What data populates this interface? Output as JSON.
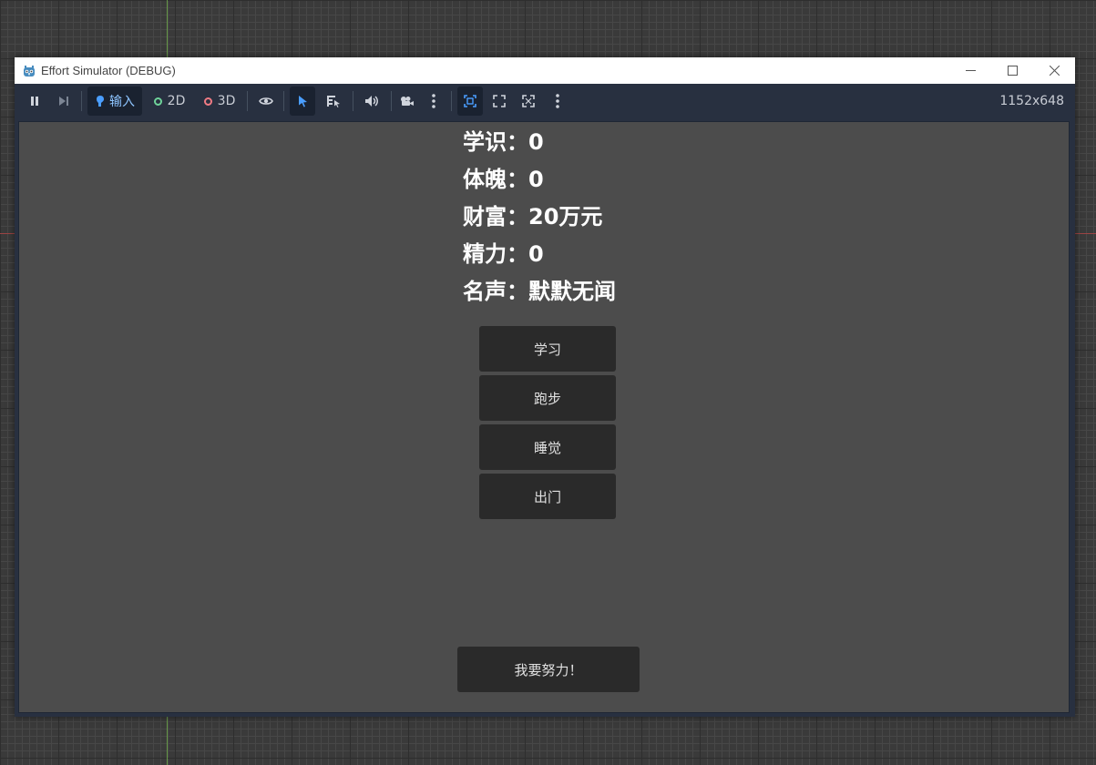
{
  "window": {
    "title": "Effort Simulator (DEBUG)"
  },
  "toolbar": {
    "input_label": "输入",
    "label_2d": "2D",
    "label_3d": "3D",
    "resolution": "1152x648",
    "icons": [
      "pause-icon",
      "step-icon",
      "input-icon",
      "eye-icon",
      "select-icon",
      "list-select-icon",
      "speaker-icon",
      "camera-icon",
      "more-icon",
      "fit-icon",
      "expand-icon",
      "fullscreen-icon",
      "more-icon"
    ],
    "colors": {
      "accent": "#4a9eff",
      "radio_2d": "#6fd39a",
      "radio_3d": "#f07b84"
    }
  },
  "game": {
    "stats": [
      {
        "label": "学识",
        "sep": "：",
        "value": "0"
      },
      {
        "label": "体魄",
        "sep": "：",
        "value": "0"
      },
      {
        "label": "财富",
        "sep": "：",
        "value": "20万元"
      },
      {
        "label": "精力",
        "sep": "：",
        "value": "0"
      },
      {
        "label": "名声",
        "sep": "：",
        "value": "默默无闻"
      }
    ],
    "actions": [
      "学习",
      "跑步",
      "睡觉",
      "出门"
    ],
    "main_button": "我要努力！"
  }
}
